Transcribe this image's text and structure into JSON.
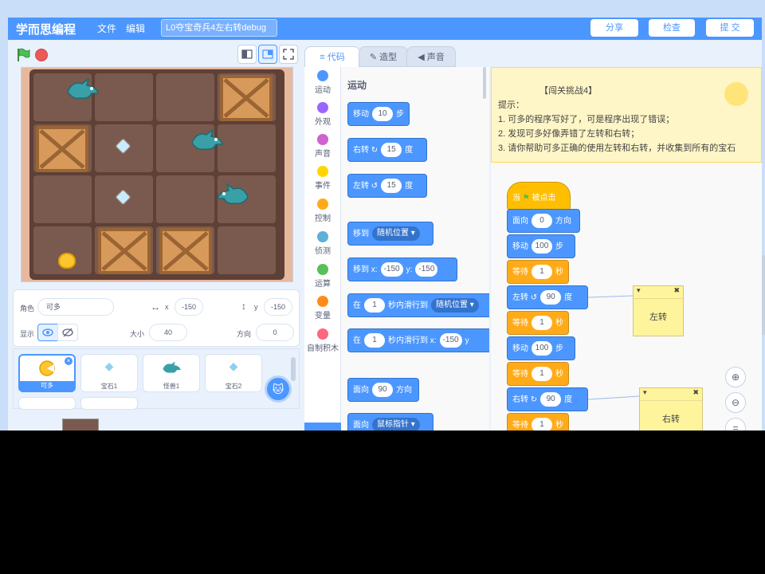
{
  "menubar": {
    "logo": "学而思编程",
    "menu_file": "文件",
    "menu_edit": "编辑",
    "project_title": "L0夺宝奇兵4左右转debug",
    "share": "分享",
    "check": "检查",
    "submit": "提 交"
  },
  "tabs": {
    "code": "代码",
    "costumes": "造型",
    "sounds": "声音"
  },
  "categories": [
    {
      "label": "运动",
      "color": "#4c97ff"
    },
    {
      "label": "外观",
      "color": "#9966ff"
    },
    {
      "label": "声音",
      "color": "#cf63cf"
    },
    {
      "label": "事件",
      "color": "#ffd500"
    },
    {
      "label": "控制",
      "color": "#ffab19"
    },
    {
      "label": "侦测",
      "color": "#5cb1d6"
    },
    {
      "label": "运算",
      "color": "#59c059"
    },
    {
      "label": "变量",
      "color": "#ff8c1a"
    },
    {
      "label": "自制积木",
      "color": "#ff6680"
    }
  ],
  "palette": {
    "section_title": "运动",
    "move": {
      "text": "移动",
      "value": "10",
      "unit": "步"
    },
    "turn_right": {
      "text": "右转",
      "value": "15",
      "unit": "度"
    },
    "turn_left": {
      "text": "左转",
      "value": "15",
      "unit": "度"
    },
    "goto": {
      "text": "移到",
      "dropdown": "随机位置"
    },
    "goto_xy": {
      "text": "移到 x:",
      "x": "-150",
      "ylabel": "y:",
      "y": "-150"
    },
    "glide_random": {
      "text": "在",
      "secs": "1",
      "mid": "秒内滑行到",
      "dropdown": "随机位置"
    },
    "glide_xy": {
      "text": "在",
      "secs": "1",
      "mid": "秒内滑行到 x:",
      "x": "-150",
      "ylabel": "y"
    },
    "point_dir": {
      "text": "面向",
      "value": "90",
      "unit": "方向"
    },
    "point_towards": {
      "text": "面向",
      "dropdown": "鼠标指针"
    }
  },
  "sprite_info": {
    "sprite_label": "角色",
    "sprite_name": "可多",
    "x_label": "x",
    "x_value": "-150",
    "y_label": "y",
    "y_value": "-150",
    "show_label": "显示",
    "size_label": "大小",
    "size_value": "40",
    "direction_label": "方向",
    "direction_value": "0"
  },
  "sprites": [
    {
      "name": "可多",
      "selected": true
    },
    {
      "name": "宝石1",
      "selected": false
    },
    {
      "name": "怪兽1",
      "selected": false
    },
    {
      "name": "宝石2",
      "selected": false
    }
  ],
  "hint": {
    "title": "【闯关挑战4】",
    "line0": "提示：",
    "line1": "1. 可多的程序写好了，可是程序出现了错误；",
    "line2": "2. 发现可多好像弄错了左转和右转；",
    "line3": "3. 请你帮助可多正确的使用左转和右转，并收集到所有的宝石"
  },
  "script": {
    "hat": "当",
    "hat_tail": "被点击",
    "point": {
      "text": "面向",
      "value": "0",
      "unit": "方向"
    },
    "move1": {
      "text": "移动",
      "value": "100",
      "unit": "步"
    },
    "wait1": {
      "text": "等待",
      "value": "1",
      "unit": "秒"
    },
    "turn_left": {
      "text": "左转",
      "value": "90",
      "unit": "度"
    },
    "wait2": {
      "text": "等待",
      "value": "1",
      "unit": "秒"
    },
    "move2": {
      "text": "移动",
      "value": "100",
      "unit": "步"
    },
    "wait3": {
      "text": "等待",
      "value": "1",
      "unit": "秒"
    },
    "turn_right": {
      "text": "右转",
      "value": "90",
      "unit": "度"
    },
    "wait4": {
      "text": "等待",
      "value": "1",
      "unit": "秒"
    }
  },
  "notes": {
    "left": "左转",
    "right": "右转"
  }
}
